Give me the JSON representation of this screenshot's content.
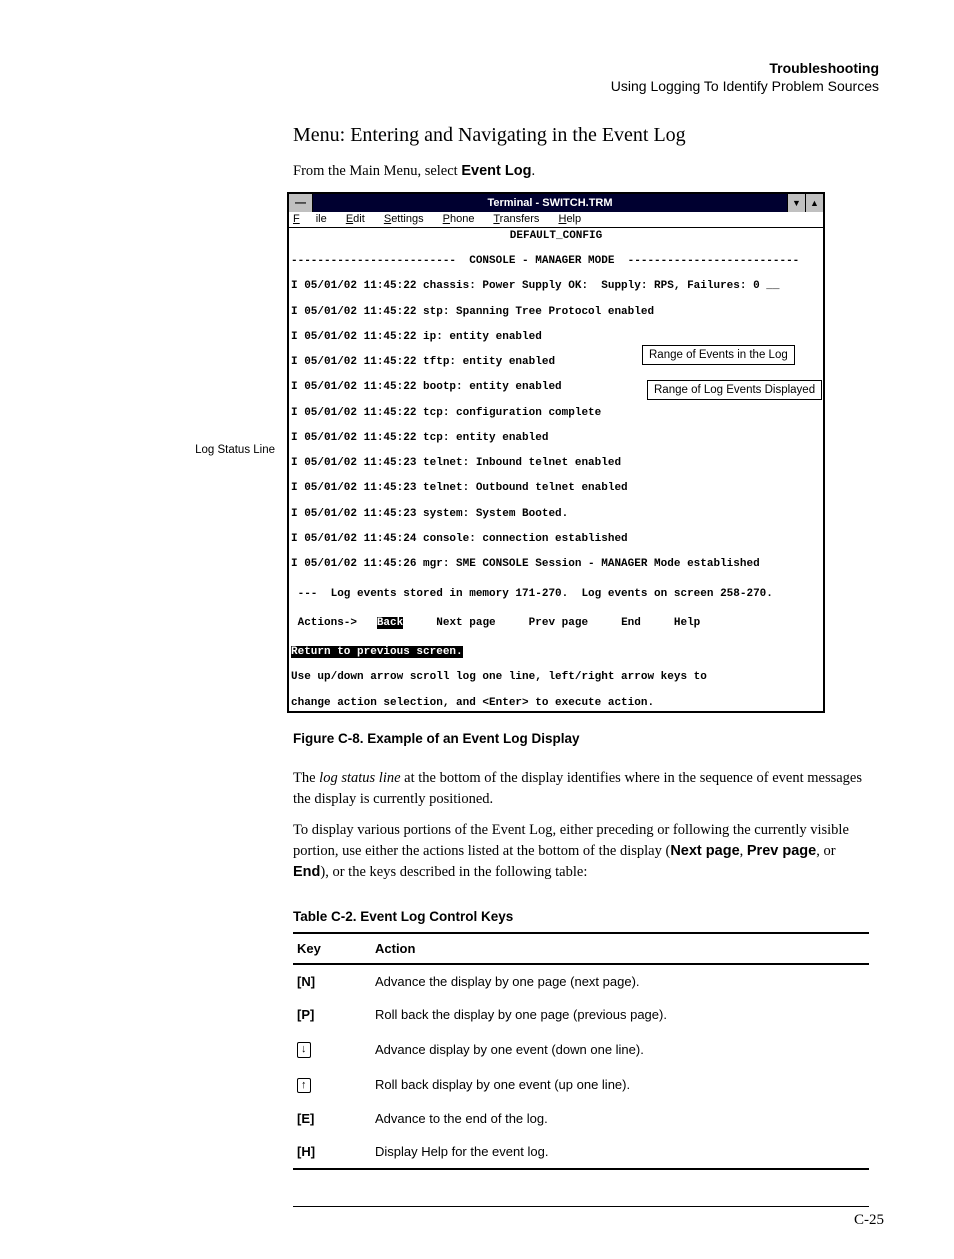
{
  "header": {
    "title": "Troubleshooting",
    "sub": "Using Logging To Identify Problem Sources"
  },
  "section": {
    "heading": "Menu: Entering and Navigating in the Event Log",
    "intro_pre": "From the Main Menu, select ",
    "intro_bold": "Event Log",
    "intro_post": "."
  },
  "terminal": {
    "title": "Terminal - SWITCH.TRM",
    "menu": {
      "m1": "File",
      "m2": "Edit",
      "m3": "Settings",
      "m4": "Phone",
      "m5": "Transfers",
      "m6": "Help"
    },
    "config_line": "DEFAULT_CONFIG",
    "mode_line": "-------------------------  CONSOLE - MANAGER MODE  --------------------------",
    "log01": "I 05/01/02 11:45:22 chassis: Power Supply OK:  Supply: RPS, Failures: 0 __",
    "log02": "I 05/01/02 11:45:22 stp: Spanning Tree Protocol enabled",
    "log03": "I 05/01/02 11:45:22 ip: entity enabled",
    "log04": "I 05/01/02 11:45:22 tftp: entity enabled",
    "log05": "I 05/01/02 11:45:22 bootp: entity enabled",
    "log06": "I 05/01/02 11:45:22 tcp: configuration complete",
    "log07": "I 05/01/02 11:45:22 tcp: entity enabled",
    "log08": "I 05/01/02 11:45:23 telnet: Inbound telnet enabled",
    "log09": "I 05/01/02 11:45:23 telnet: Outbound telnet enabled",
    "log10": "I 05/01/02 11:45:23 system: System Booted.",
    "log11": "I 05/01/02 11:45:24 console: connection established",
    "log12": "I 05/01/02 11:45:26 mgr: SME CONSOLE Session - MANAGER Mode established",
    "status": " ---  Log events stored in memory 171-270.  Log events on screen 258-270.",
    "actions_pre": " Actions->   ",
    "actions_back": "Back",
    "actions_post": "     Next page     Prev page     End     Help",
    "footer1": "Return to previous screen.",
    "footer2": "Use up/down arrow scroll log one line, left/right arrow keys to",
    "footer3": "change action selection, and <Enter> to execute action."
  },
  "callouts": {
    "range_log": "Range of Events in the Log",
    "range_disp": "Range of Log Events Displayed",
    "side": "Log Status Line"
  },
  "figure_caption": "Figure C-8.   Example of an Event Log Display",
  "para1_pre": "The ",
  "para1_em": "log status line",
  "para1_post": " at the bottom of the display identifies where in the sequence of event messages the display is currently positioned.",
  "para2_pre": "To display various portions of the Event Log, either preceding or following the currently visible portion, use either the actions listed at the bottom of the display (",
  "para2_b1": "Next page",
  "para2_s1": ", ",
  "para2_b2": "Prev page",
  "para2_s2": ", or ",
  "para2_b3": "End",
  "para2_post": "), or the keys described in the following table:",
  "table_caption": "Table C-2.    Event Log Control Keys",
  "table": {
    "h1": "Key",
    "h2": "Action",
    "rows": [
      {
        "k": "[N]",
        "a": "Advance the display by one page (next page)."
      },
      {
        "k": "[P]",
        "a": "Roll back the display by one page (previous page)."
      },
      {
        "k": "↓",
        "a": "Advance display by one event (down one line)."
      },
      {
        "k": "↑",
        "a": "Roll back display by one event (up one line)."
      },
      {
        "k": "[E]",
        "a": "Advance to the end of the log."
      },
      {
        "k": "[H]",
        "a": "Display Help for the event log."
      }
    ]
  },
  "page_num": "C-25"
}
